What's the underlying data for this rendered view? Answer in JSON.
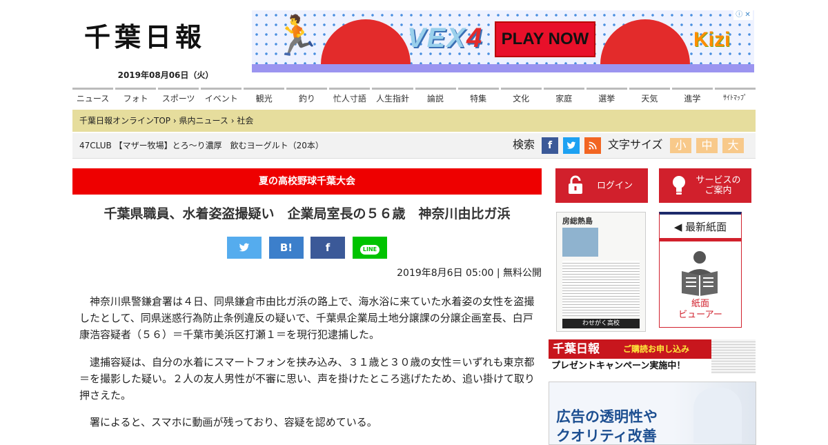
{
  "header": {
    "logo": "千葉日報",
    "date": "2019年08月06日（火）"
  },
  "ad": {
    "choice": "ⓘ ✕",
    "vex": "VEX",
    "vex_num": "4",
    "play": "PLAY NOW",
    "kizi": "Kizi"
  },
  "nav": [
    "ニュース",
    "フォト",
    "スポーツ",
    "イベント",
    "観光",
    "釣り",
    "忙人寸語",
    "人生指針",
    "論説",
    "特集",
    "文化",
    "家庭",
    "選挙",
    "天気",
    "進学",
    "ｻｲﾄﾏｯﾌﾟ"
  ],
  "breadcrumb": {
    "home": "千葉日報オンラインTOP",
    "sep": "›",
    "section": "県内ニュース",
    "current": "社会"
  },
  "ticker": "47CLUB 【マザー牧場】とろ～り濃厚　飲むヨーグルト（20本）",
  "toolbar": {
    "search_label": "検索",
    "font_size_label": "文字サイズ",
    "font_sizes": [
      "小",
      "中",
      "大"
    ],
    "colors": {
      "facebook": "#3b5998",
      "twitter": "#1da1f2",
      "rss": "#f26522"
    }
  },
  "article": {
    "topic": "夏の高校野球千葉大会",
    "headline": "千葉県職員、水着姿盗撮疑い　企業局室長の５６歳　神奈川由比ガ浜",
    "share": {
      "hatena": "B!",
      "line": "LINE"
    },
    "meta": "2019年8月6日 05:00 | 無料公開",
    "paragraphs": [
      "神奈川県警鎌倉署は４日、同県鎌倉市由比ガ浜の路上で、海水浴に来ていた水着姿の女性を盗撮したとして、同県迷惑行為防止条例違反の疑いで、千葉県企業局土地分譲課の分譲企画室長、白戸康浩容疑者（５６）＝千葉市美浜区打瀬１＝を現行犯逮捕した。",
      "逮捕容疑は、自分の水着にスマートフォンを挟み込み、３１歳と３０歳の女性＝いずれも東京都＝を撮影した疑い。２人の友人男性が不審に思い、声を掛けたところ逃げたため、追い掛けて取り押さえた。",
      "署によると、スマホに動画が残っており、容疑を認めている。"
    ]
  },
  "sidebar": {
    "login": "ログイン",
    "services": "サービスの\nご案内",
    "paper_thumb": {
      "title": "房総熱島",
      "footer": "わせがく高校"
    },
    "latest_title": "◀ 最新紙面",
    "viewer": "紙面\nビューアー",
    "subscribe": {
      "logo": "千葉日報",
      "apply": "ご購読お申し込み",
      "promo": "プレゼントキャンペーン実施中！"
    },
    "ad": {
      "line1": "広告の透明性や",
      "line2": "クオリティ改善"
    }
  },
  "colors": {
    "accent_red": "#e00000",
    "crumb_bg": "#e6dd9d",
    "font_btn": "#f8c98a"
  }
}
